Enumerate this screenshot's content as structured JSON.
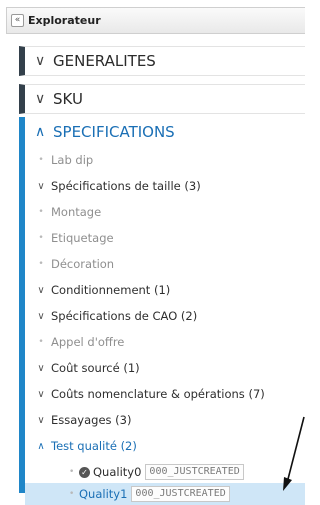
{
  "panel": {
    "title": "Explorateur",
    "collapse_icon": "«"
  },
  "sections": [
    {
      "label": "GENERALITES",
      "chevron": "∨"
    },
    {
      "label": "SKU",
      "chevron": "∨"
    }
  ],
  "specifications": {
    "label": "SPECIFICATIONS",
    "chevron": "∧",
    "items": [
      {
        "label": "Lab dip",
        "marker": "•",
        "state": "disabled"
      },
      {
        "label": "Spécifications de taille (3)",
        "marker": "∨",
        "state": "collapsed"
      },
      {
        "label": "Montage",
        "marker": "•",
        "state": "disabled"
      },
      {
        "label": "Etiquetage",
        "marker": "•",
        "state": "disabled"
      },
      {
        "label": "Décoration",
        "marker": "•",
        "state": "disabled"
      },
      {
        "label": "Conditionnement (1)",
        "marker": "∨",
        "state": "collapsed"
      },
      {
        "label": "Spécifications de CAO (2)",
        "marker": "∨",
        "state": "collapsed"
      },
      {
        "label": "Appel d'offre",
        "marker": "•",
        "state": "disabled"
      },
      {
        "label": "Coût sourcé (1)",
        "marker": "∨",
        "state": "collapsed"
      },
      {
        "label": "Coûts nomenclature & opérations (7)",
        "marker": "∨",
        "state": "collapsed"
      },
      {
        "label": "Essayages (3)",
        "marker": "∨",
        "state": "collapsed"
      },
      {
        "label": "Test qualité (2)",
        "marker": "∧",
        "state": "expanded"
      }
    ],
    "quality_children": [
      {
        "label": "Quality0",
        "tag": "000_JUSTCREATED",
        "check_icon": "✓"
      },
      {
        "label": "Quality1",
        "tag": "000_JUSTCREATED"
      }
    ]
  },
  "colors": {
    "dark_bar": "#33404b",
    "blue_bar": "#1f86c8",
    "link_blue": "#1a6fb5",
    "selection": "#cfe6f7"
  }
}
